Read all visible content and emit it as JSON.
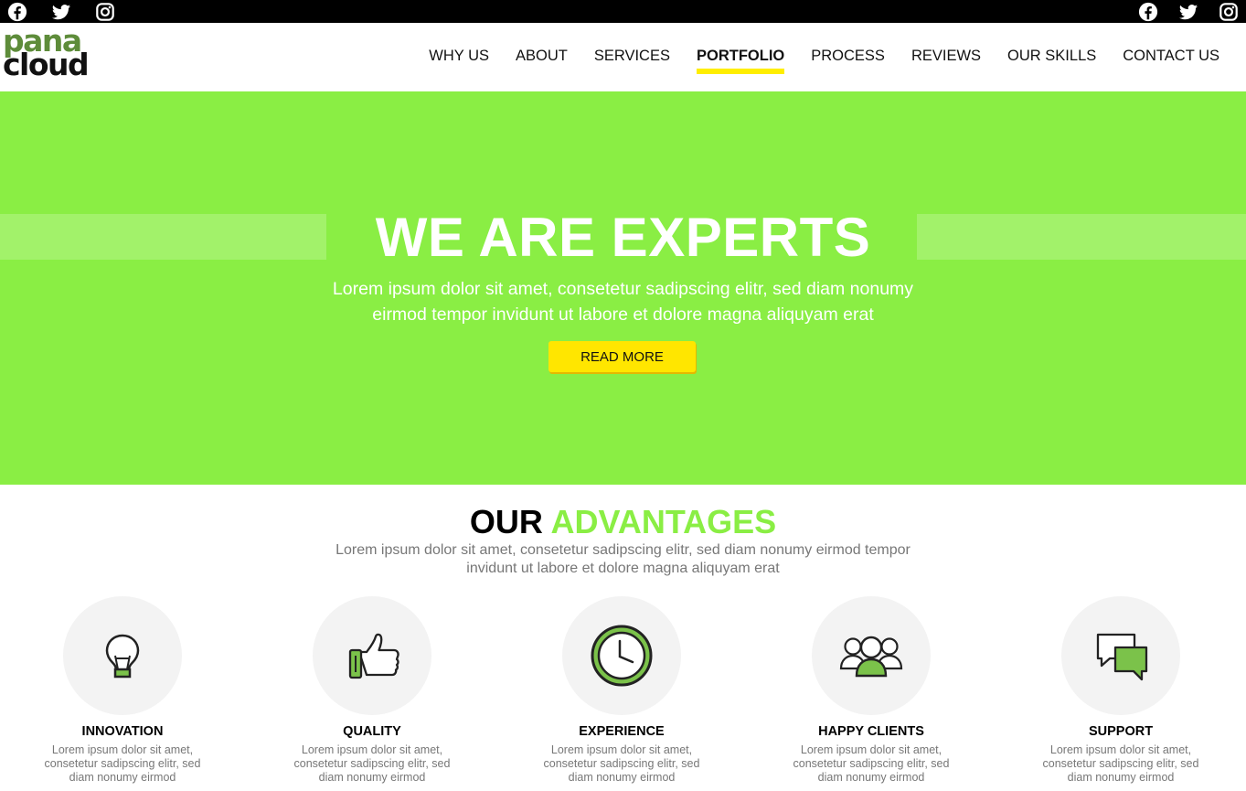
{
  "social": {
    "left": [
      {
        "icon": "facebook-icon"
      },
      {
        "icon": "twitter-icon"
      },
      {
        "icon": "instagram-icon"
      }
    ],
    "right": [
      {
        "icon": "facebook-icon"
      },
      {
        "icon": "twitter-icon"
      },
      {
        "icon": "instagram-icon"
      }
    ]
  },
  "logo": {
    "line1": "pana",
    "line2": "cloud"
  },
  "nav": {
    "items": [
      "WHY US",
      "ABOUT",
      "SERVICES",
      "PORTFOLIO",
      "PROCESS",
      "REVIEWS",
      "OUR SKILLS",
      "CONTACT US"
    ],
    "active": "PORTFOLIO"
  },
  "hero": {
    "title": "WE ARE EXPERTS",
    "subtitle": "Lorem ipsum dolor sit amet, consetetur sadipscing elitr, sed diam nonumy eirmod tempor invidunt ut labore et dolore magna aliquyam erat",
    "button_label": "READ MORE"
  },
  "advantages": {
    "title_part1": "OUR",
    "title_part2": "ADVANTAGES",
    "subtitle": "Lorem ipsum dolor sit amet, consetetur sadipscing elitr, sed diam nonumy eirmod tempor invidunt ut labore et dolore magna aliquyam erat",
    "cards": [
      {
        "icon": "lightbulb-icon",
        "title": "INNOVATION",
        "text": "Lorem ipsum dolor sit amet, consetetur sadipscing elitr, sed diam nonumy eirmod"
      },
      {
        "icon": "thumbs-up-icon",
        "title": "QUALITY",
        "text": "Lorem ipsum dolor sit amet, consetetur sadipscing elitr, sed diam nonumy eirmod"
      },
      {
        "icon": "clock-icon",
        "title": "EXPERIENCE",
        "text": "Lorem ipsum dolor sit amet, consetetur sadipscing elitr, sed diam nonumy eirmod"
      },
      {
        "icon": "people-icon",
        "title": "HAPPY CLIENTS",
        "text": "Lorem ipsum dolor sit amet, consetetur sadipscing elitr, sed diam nonumy eirmod"
      },
      {
        "icon": "chat-bubbles-icon",
        "title": "SUPPORT",
        "text": "Lorem ipsum dolor sit amet, consetetur sadipscing elitr, sed diam nonumy eirmod"
      }
    ]
  },
  "colors": {
    "hero_bg": "#8aee44",
    "accent_yellow": "#ffe600",
    "accent_green": "#8aee44",
    "icon_green": "#7bc24a",
    "logo_green": "#5e8c3a"
  }
}
